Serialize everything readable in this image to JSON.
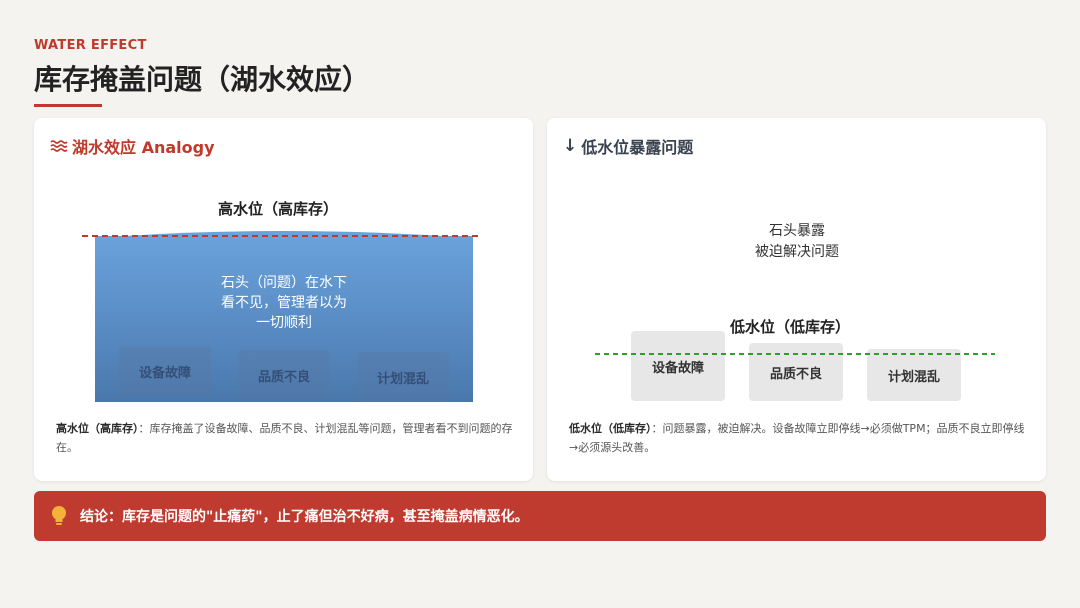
{
  "header": {
    "eyebrow": "WATER EFFECT",
    "title": "库存掩盖问题（湖水效应）"
  },
  "left_card": {
    "icon": "waves-icon",
    "heading": "湖水效应 Analogy",
    "level_label": "高水位（高库存）",
    "water_text_lines": [
      "石头（问题）在水下",
      "看不见，管理者以为",
      "一切顺利"
    ],
    "rocks": [
      "设备故障",
      "品质不良",
      "计划混乱"
    ],
    "note_label": "高水位（高库存）",
    "note_text": "：库存掩盖了设备故障、品质不良、计划混乱等问题，管理者看不到问题的存在。"
  },
  "right_card": {
    "icon": "arrow-down-icon",
    "heading": "低水位暴露问题",
    "exposed_lines": [
      "石头暴露",
      "被迫解决问题"
    ],
    "level_label": "低水位（低库存）",
    "rocks": [
      "设备故障",
      "品质不良",
      "计划混乱"
    ],
    "note_label": "低水位（低库存）",
    "note_text": "：问题暴露，被迫解决。设备故障立即停线→必须做TPM；品质不良立即停线→必须源头改善。"
  },
  "banner": {
    "icon": "lightbulb-icon",
    "text": "结论：库存是问题的\"止痛药\"，止了痛但治不好病，甚至掩盖病情恶化。"
  },
  "colors": {
    "accent": "#c0392b",
    "banner": "#bf3a2f",
    "water_top": "#6aa2dc",
    "water_bottom": "#4a78ad",
    "high_line": "#c0392b",
    "low_line": "#2e9e2e"
  }
}
